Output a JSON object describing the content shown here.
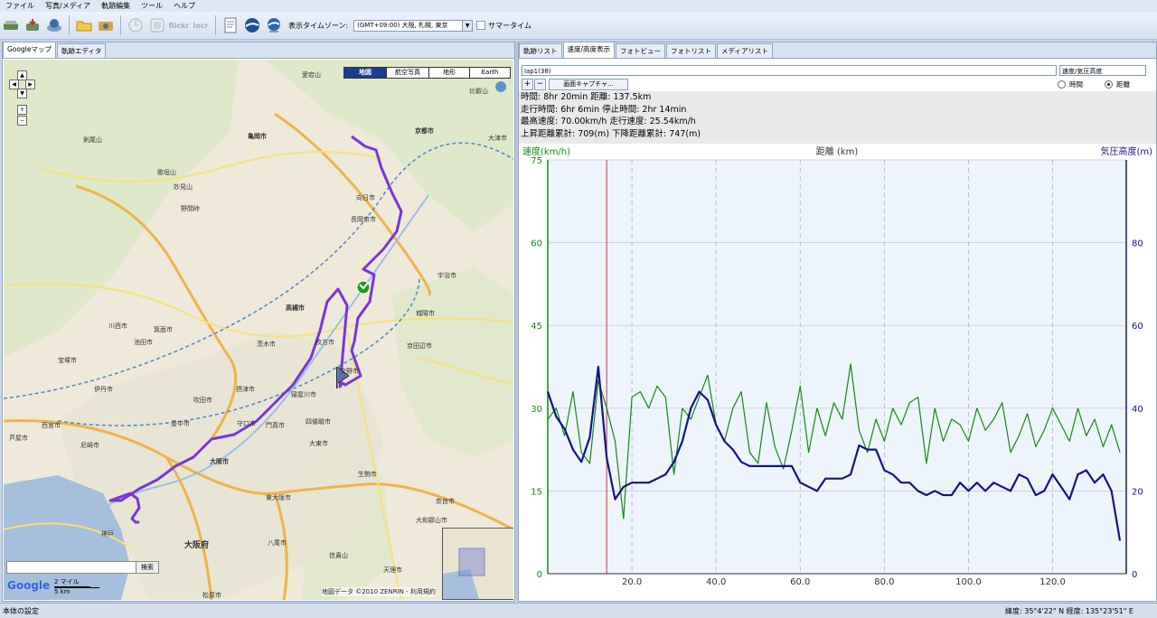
{
  "menu": [
    "ファイル",
    "写真/メディア",
    "軌跡編集",
    "ツール",
    "ヘルプ"
  ],
  "toolbar": {
    "icons": [
      "hard-drive-icon",
      "gps-download-icon",
      "globe-device-icon",
      "open-folder-icon",
      "camera-icon",
      "clock-icon",
      "photo-frame-icon",
      "flickr-icon",
      "locr-icon",
      "document-icon",
      "google-earth-icon",
      "earth-blue-icon"
    ],
    "flickr_label": "flickr",
    "locr_label": "locr",
    "tz_label": "表示タイムゾーン:",
    "tz_value": "(GMT+09:00) 大阪, 札幌, 東京",
    "summer_label": "サマータイム"
  },
  "left_tabs": [
    "Googleマップ",
    "軌跡エディタ"
  ],
  "map": {
    "types": [
      "地図",
      "航空写真",
      "地形",
      "Earth"
    ],
    "search_button": "検索",
    "logo": "Google",
    "scale_top": "2 マイル",
    "scale_bottom": "5 km",
    "credit": "地図データ ©2010 ZENRIN - 利用規約",
    "labels": [
      "愛宕山",
      "亀岡市",
      "京都市",
      "向日市",
      "長岡京市",
      "高槻市",
      "茨木市",
      "枚方市",
      "寝屋川市",
      "交野市",
      "門真市",
      "守口市",
      "四條畷市",
      "大東市",
      "東大阪市",
      "大阪市",
      "摂津市",
      "吹田市",
      "豊中市",
      "箕面市",
      "池田市",
      "川西市",
      "宝塚市",
      "伊丹市",
      "尼崎市",
      "西宮市",
      "芦屋市",
      "神戸",
      "八尾市",
      "生駒市",
      "奈良市",
      "大和郡山市",
      "京田辺市",
      "城陽市",
      "宇治市",
      "大津市",
      "比叡山",
      "剣尾山",
      "歌垣山",
      "妙見山",
      "野間峠",
      "大阪府",
      "松原市",
      "信貴山",
      "天理市"
    ]
  },
  "right_tabs": [
    "軌跡リスト",
    "速度/高度表示",
    "フォトビュー",
    "フォトリスト",
    "メディアリスト"
  ],
  "graph_controls": {
    "lap": "lap1(38)",
    "mode": "速度/気圧高度",
    "plus": "+",
    "minus": "−",
    "capture": "画面キャプチャ...",
    "radio_time": "時間",
    "radio_distance": "距離"
  },
  "stats": [
    "時間: 8hr 20min  距離: 137.5km",
    "走行時間: 6hr 6min  停止時間: 2hr 14min",
    "最高速度: 70.00km/h  走行速度: 25.54km/h",
    "上昇距離累計: 709(m)  下降距離累計: 747(m)"
  ],
  "chart_data": {
    "type": "line",
    "ylabel_left": "速度(km/h)",
    "xlabel": "距離 (km)",
    "ylabel_right": "気圧高度(m)",
    "xlim": [
      0,
      137.5
    ],
    "ylim_left": [
      0,
      75
    ],
    "ylim_right": [
      0,
      100
    ],
    "x_ticks": [
      "20.0",
      "40.0",
      "60.0",
      "80.0",
      "100.0",
      "120.0"
    ],
    "y_left_ticks": [
      "0",
      "15",
      "30",
      "45",
      "60",
      "75"
    ],
    "y_right_ticks": [
      "0",
      "20",
      "40",
      "60",
      "80"
    ],
    "marker_x": 14.0,
    "grid": true,
    "series": [
      {
        "name": "速度",
        "color": "#118a11",
        "x": [
          0,
          2,
          4,
          6,
          8,
          10,
          12,
          14,
          16,
          18,
          20,
          22,
          24,
          26,
          28,
          30,
          32,
          34,
          36,
          38,
          40,
          42,
          44,
          46,
          48,
          50,
          52,
          54,
          56,
          58,
          60,
          62,
          64,
          66,
          68,
          70,
          72,
          74,
          76,
          78,
          80,
          82,
          84,
          86,
          88,
          90,
          92,
          94,
          96,
          98,
          100,
          102,
          104,
          106,
          108,
          110,
          112,
          114,
          116,
          118,
          120,
          122,
          124,
          126,
          128,
          130,
          132,
          134,
          136
        ],
        "values": [
          28,
          30,
          25,
          33,
          22,
          20,
          35,
          30,
          24,
          10,
          32,
          33,
          30,
          34,
          32,
          18,
          30,
          28,
          32,
          36,
          27,
          24,
          30,
          33,
          22,
          20,
          31,
          23,
          19,
          26,
          34,
          22,
          30,
          25,
          31,
          28,
          38,
          26,
          22,
          28,
          24,
          30,
          27,
          31,
          32,
          20,
          30,
          24,
          28,
          27,
          24,
          30,
          26,
          28,
          31,
          22,
          25,
          29,
          23,
          26,
          30,
          27,
          24,
          30,
          25,
          28,
          23,
          27,
          22
        ]
      },
      {
        "name": "気圧高度",
        "color": "#141482",
        "x": [
          0,
          2,
          4,
          6,
          8,
          10,
          12,
          14,
          16,
          18,
          20,
          22,
          24,
          26,
          28,
          30,
          32,
          34,
          36,
          38,
          40,
          42,
          44,
          46,
          48,
          50,
          52,
          54,
          56,
          58,
          60,
          62,
          64,
          66,
          68,
          70,
          72,
          74,
          76,
          78,
          80,
          82,
          84,
          86,
          88,
          90,
          92,
          94,
          96,
          98,
          100,
          102,
          104,
          106,
          108,
          110,
          112,
          114,
          116,
          118,
          120,
          122,
          124,
          126,
          128,
          130,
          132,
          134,
          136
        ],
        "values": [
          44,
          38,
          35,
          30,
          27,
          33,
          50,
          28,
          18,
          21,
          22,
          22,
          22,
          23,
          24,
          27,
          32,
          40,
          44,
          42,
          36,
          32,
          30,
          27,
          26,
          26,
          26,
          26,
          26,
          26,
          22,
          21,
          20,
          23,
          23,
          23,
          24,
          31,
          30,
          30,
          25,
          24,
          22,
          22,
          20,
          19,
          20,
          19,
          19,
          22,
          20,
          22,
          20,
          22,
          21,
          20,
          24,
          23,
          19,
          20,
          24,
          21,
          18,
          24,
          25,
          22,
          24,
          20,
          8
        ]
      }
    ]
  },
  "status": {
    "left": "本体の設定",
    "right": "緯度: 35°4'22\" N  経度: 135°23'51\" E"
  }
}
